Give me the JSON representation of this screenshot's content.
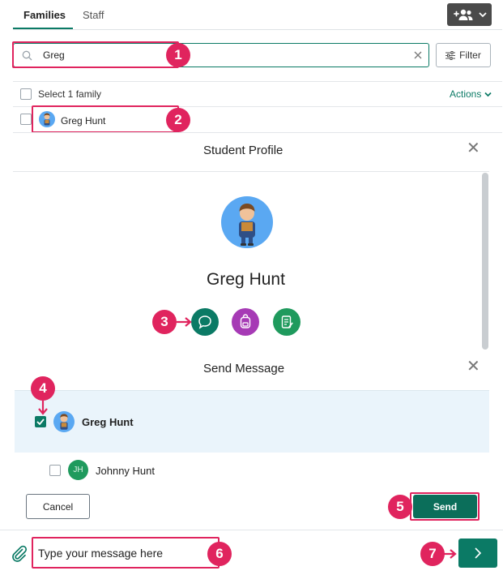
{
  "tabs": [
    {
      "label": "Families",
      "active": true
    },
    {
      "label": "Staff",
      "active": false
    }
  ],
  "add_button_icon": "add-people-icon",
  "search": {
    "value": "Greg",
    "placeholder": ""
  },
  "filter_label": "Filter",
  "select_label": "Select 1 family",
  "actions_label": "Actions",
  "result": {
    "name": "Greg Hunt"
  },
  "student_profile": {
    "title": "Student Profile",
    "name": "Greg Hunt",
    "action_icons": [
      "chat-icon",
      "backpack-icon",
      "notes-icon"
    ]
  },
  "send_message": {
    "title": "Send Message",
    "recipients": [
      {
        "name": "Greg Hunt",
        "checked": true
      },
      {
        "name": "Johnny Hunt",
        "initials": "JH",
        "checked": false
      }
    ],
    "cancel_label": "Cancel",
    "send_label": "Send"
  },
  "composer": {
    "placeholder": "Type your message here"
  },
  "callouts": [
    "1",
    "2",
    "3",
    "4",
    "5",
    "6",
    "7"
  ],
  "colors": {
    "accent": "#0b7a65",
    "highlight": "#e0245e",
    "backpack": "#a63ab5",
    "notes": "#1f9a5d"
  }
}
